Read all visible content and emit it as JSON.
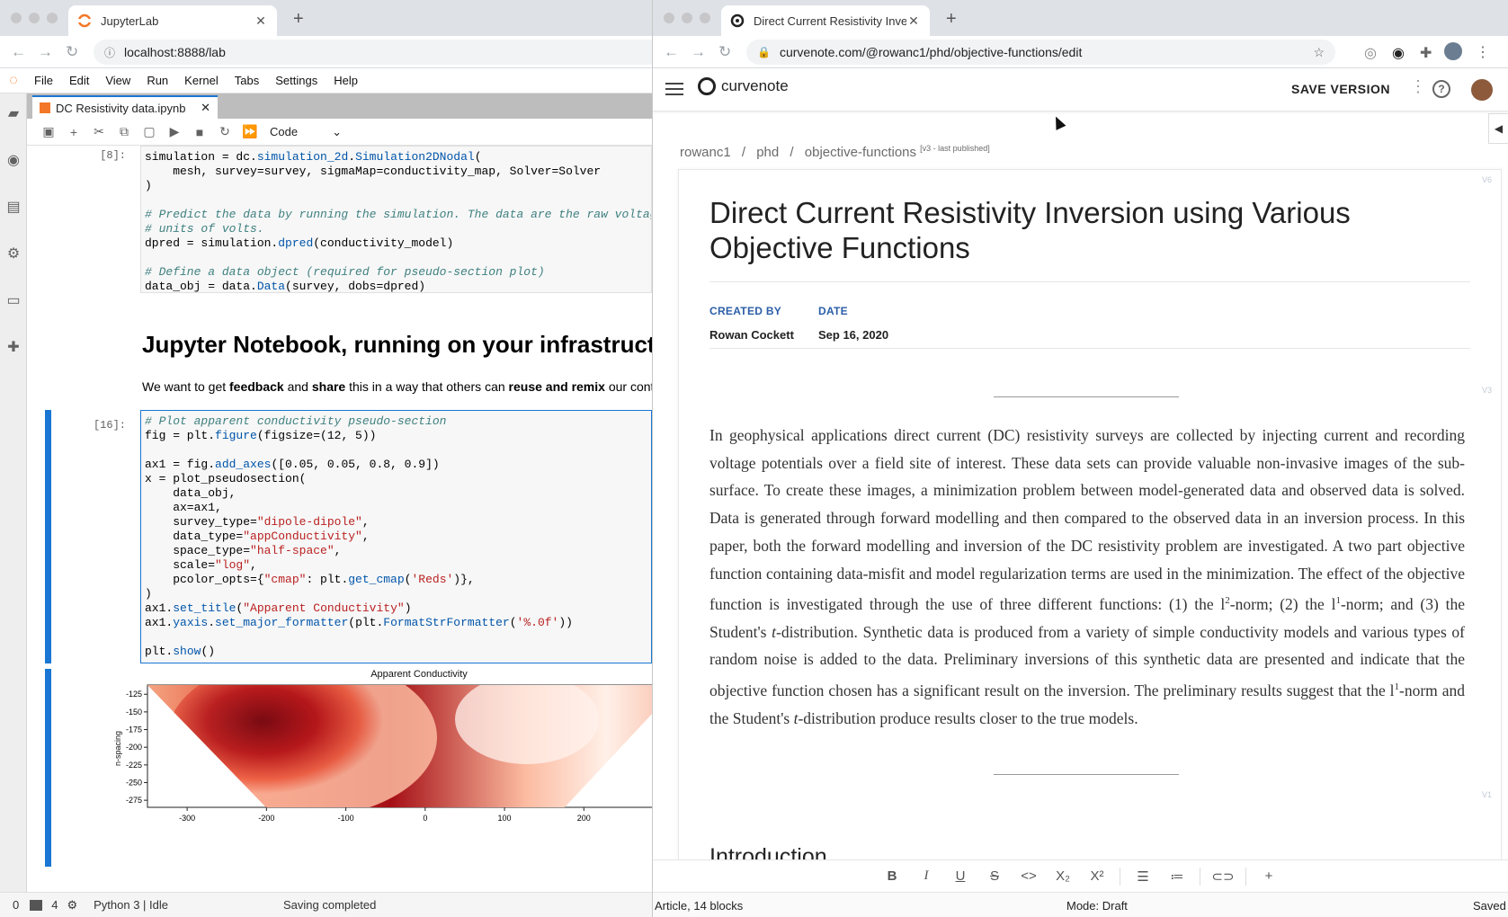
{
  "left_browser": {
    "tab_title": "JupyterLab",
    "url": "localhost:8888/lab"
  },
  "jupyter": {
    "menu": [
      "File",
      "Edit",
      "View",
      "Run",
      "Kernel",
      "Tabs",
      "Settings",
      "Help"
    ],
    "notebook_tab": "DC Resistivity data.ipynb",
    "cell_type": "Code",
    "cell8_prompt": "[8]:",
    "cell8_lines": [
      "simulation = dc.simulation_2d.Simulation2DNodal(",
      "    mesh, survey=survey, sigmaMap=conductivity_map, Solver=Solver",
      ")",
      "",
      "# Predict the data by running the simulation. The data are the raw voltage i",
      "# units of volts.",
      "dpred = simulation.dpred(conductivity_model)",
      "",
      "# Define a data object (required for pseudo-section plot)",
      "data_obj = data.Data(survey, dobs=dpred)"
    ],
    "md_heading": "Jupyter Notebook, running on your infrastructu",
    "md_text_parts": [
      "We want to get ",
      "feedback",
      " and ",
      "share",
      " this in a way that others can ",
      "reuse and remix",
      " our conte"
    ],
    "cell16_prompt": "[16]:",
    "cell16_lines": [
      "# Plot apparent conductivity pseudo-section",
      "fig = plt.figure(figsize=(12, 5))",
      "",
      "ax1 = fig.add_axes([0.05, 0.05, 0.8, 0.9])",
      "x = plot_pseudosection(",
      "    data_obj,",
      "    ax=ax1,",
      "    survey_type=\"dipole-dipole\",",
      "    data_type=\"appConductivity\",",
      "    space_type=\"half-space\",",
      "    scale=\"log\",",
      "    pcolor_opts={\"cmap\": plt.get_cmap('Reds')},",
      ")",
      "ax1.set_title(\"Apparent Conductivity\")",
      "ax1.yaxis.set_major_formatter(plt.FormatStrFormatter('%.0f'))",
      "",
      "plt.show()"
    ],
    "status": {
      "left_a": "0",
      "left_b": "4",
      "kernel": "Python 3 | Idle",
      "message": "Saving completed"
    }
  },
  "chart_data": {
    "type": "heatmap",
    "title": "Apparent Conductivity",
    "ylabel": "n-spacing",
    "xlabel": "",
    "x_ticks": [
      -300,
      -200,
      -100,
      0,
      100,
      200
    ],
    "y_ticks": [
      -125,
      -150,
      -175,
      -200,
      -225,
      -250,
      -275
    ],
    "colormap": "Reds"
  },
  "right_browser": {
    "tab_title": "Direct Current Resistivity Inver",
    "url": "curvenote.com/@rowanc1/phd/objective-functions/edit"
  },
  "curvenote": {
    "logo_text": "curvenote",
    "save_label": "SAVE VERSION",
    "help_label": "?",
    "breadcrumb": [
      "rowanc1",
      "phd",
      "objective-functions"
    ],
    "version_note": "[v3 - last published]",
    "title": "Direct Current Resistivity Inversion using Various Objective Functions",
    "created_by_label": "CREATED BY",
    "created_by_value": "Rowan Cockett",
    "date_label": "DATE",
    "date_value": "Sep 16, 2020",
    "abstract": {
      "p1": "In geophysical applications direct current (DC) resistivity surveys are collected by injecting current and recording voltage potentials over a field site of interest. These data sets can provide valuable non-invasive images of the sub-surface. To create these images, a minimization problem between model-generated data and observed data is solved. Data is generated through forward modelling and then compared to the observed data in an inversion process. In this paper, both the forward modelling and inversion of the DC resistivity problem are investigated. A two part objective function containing data-misfit and model regularization terms are used in the minimization. The effect of the objective function is investigated through the use of three different functions: (1) the l",
      "sup2": "2",
      "p2": "-norm; (2) the l",
      "sup1a": "1",
      "p3": "-norm; and (3) the Student's ",
      "t1": "t",
      "p4": "-distribution. Synthetic data is produced from a variety of simple conductivity models and various types of random noise is added to the data. Preliminary inversions of this synthetic data are presented and indicate that the objective function chosen has a significant result on the inversion. The preliminary results suggest that the l",
      "sup1b": "1",
      "p5": "-norm and the Student's ",
      "t2": "t",
      "p6": "-distribution produce results closer to the true models."
    },
    "intro_heading": "Introduction",
    "block_marks": [
      "V6",
      "V3",
      "V1"
    ],
    "status": {
      "left": "Article, 14 blocks",
      "mode": "Mode: Draft",
      "right": "Saved"
    }
  }
}
